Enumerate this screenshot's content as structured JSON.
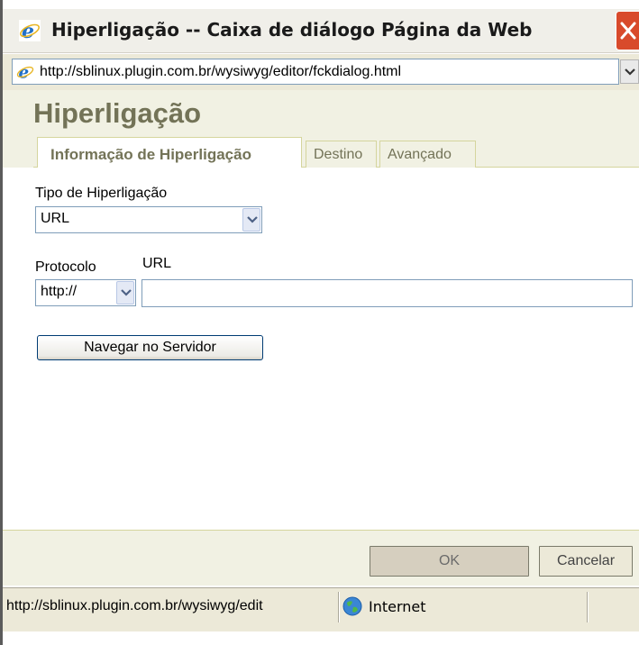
{
  "window": {
    "title": "Hiperligação -- Caixa de diálogo Página da Web"
  },
  "address_bar": {
    "url": "http://sblinux.plugin.com.br/wysiwyg/editor/fckdialog.html"
  },
  "dialog": {
    "title": "Hiperligação",
    "tabs": [
      {
        "label": "Informação de Hiperligação",
        "active": true
      },
      {
        "label": "Destino",
        "active": false
      },
      {
        "label": "Avançado",
        "active": false
      }
    ],
    "link_type": {
      "label": "Tipo de Hiperligação",
      "selected": "URL"
    },
    "protocol": {
      "label": "Protocolo",
      "selected": "http://"
    },
    "url": {
      "label": "URL",
      "value": ""
    },
    "browse_server_label": "Navegar no Servidor",
    "ok_label": "OK",
    "cancel_label": "Cancelar"
  },
  "status_bar": {
    "url": "http://sblinux.plugin.com.br/wysiwyg/edit",
    "zone": "Internet"
  },
  "colors": {
    "dialog_background": "#f1f1e3",
    "dialog_title": "#737357",
    "tab_border": "#d5d59d",
    "close_button": "#d84a2b"
  }
}
